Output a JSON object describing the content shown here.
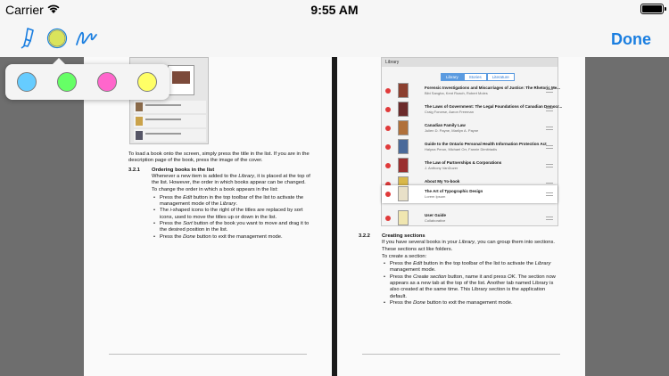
{
  "status": {
    "carrier": "Carrier",
    "time": "9:55 AM"
  },
  "toolbar": {
    "done_label": "Done",
    "tools": [
      "highlighter-pen-icon",
      "color-picker-icon",
      "freehand-icon"
    ],
    "accent_color": "#1a7ee0",
    "selected_color": "#ffff66"
  },
  "palette": {
    "colors": [
      "#66ccff",
      "#66ff66",
      "#ff66cc",
      "#ffff66"
    ],
    "names": [
      "blue",
      "green",
      "pink",
      "yellow"
    ]
  },
  "left_page": {
    "intro": "To load a book onto the screen, simply press the title in the list. If you are in the description page of the book, press the image of the cover.",
    "section": {
      "number": "3.2.1",
      "title": "Ordering books in the list"
    },
    "p1_a": "Whenever a new item is added to the ",
    "p1_em": "Library",
    "p1_b": ", it is placed at the top of the list. However, the order in which books appear can be changed.",
    "p2": "To change the order in which a book appears in the list:",
    "bullets": [
      {
        "a": "Press the ",
        "em": "Edit",
        "b": " button in the top toolbar of the list to activate the management mode of the ",
        "em2": "Library",
        "c": "."
      },
      {
        "a": "The ",
        "em": "i",
        "b": "-shaped icons to the right of the titles are replaced by sort icons, used to move the titles up or down in the list.",
        "em2": "",
        "c": ""
      },
      {
        "a": "Press the ",
        "em": "Sort",
        "b": " button of the book you want to move and drag it to the desired position in the list.",
        "em2": "",
        "c": ""
      },
      {
        "a": "Press the ",
        "em": "Done",
        "b": " button to exit the management mode.",
        "em2": "",
        "c": ""
      }
    ]
  },
  "right_page": {
    "screenshot": {
      "title": "Library",
      "tabs": [
        "Library",
        "Stories",
        "Literature"
      ],
      "books": [
        {
          "title": "Forensic Investigations and Miscarriages of Justice: The Rhetoric Me...",
          "author": "Bibi Sangha, Kent Roach, Robert Moles"
        },
        {
          "title": "The Laws of Government: The Legal Foundations of Canadian Democr...",
          "author": "Craig Forcese, Aaron Freeman"
        },
        {
          "title": "Canadian Family Law",
          "author": "Julien D. Payne, Marilyn A. Payne"
        },
        {
          "title": "Guide to the Ontario Personal Health Information Protection Act",
          "author": "Halyna Perun, Michael Orr, Fannie Dimitriadis"
        },
        {
          "title": "The Law of Partnerships & Corporations",
          "author": "J. Anthony VanDuzer"
        },
        {
          "title": "About My Yo-book",
          "author": ""
        },
        {
          "title": "The Art of Typographic Design",
          "author": "Lorem Ipsum"
        },
        {
          "title": "User Guide",
          "author": "Collaborative"
        }
      ]
    },
    "section": {
      "number": "3.2.2",
      "title": "Creating sections"
    },
    "p1_a": "If you have several books in your ",
    "p1_em": "Library",
    "p1_b": ", you can group them into sections. These sections act like folders.",
    "p2": "To create a section:",
    "bullets": [
      {
        "a": "Press the ",
        "em": "Edit",
        "b": " button in the top toolbar of the list to activate the ",
        "em2": "Library",
        "c": " management mode."
      },
      {
        "a": "Press the ",
        "em": "Create section",
        "b": " button, name it and press ",
        "em2": "OK",
        "c": ". The section now appears as a new tab at the top of the list. Another tab named Library is also created at the same time. This Library section is the application default."
      },
      {
        "a": "Press the ",
        "em": "Done",
        "b": " button to exit the management mode.",
        "em2": "",
        "c": ""
      }
    ]
  }
}
